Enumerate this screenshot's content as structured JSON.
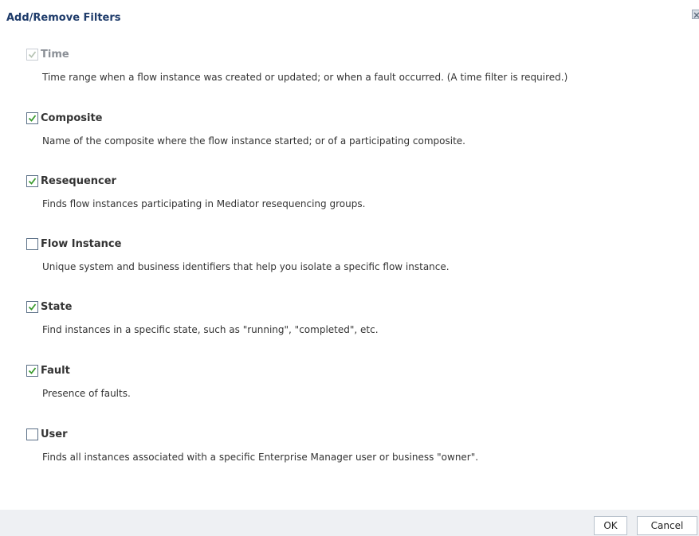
{
  "dialog": {
    "title": "Add/Remove Filters",
    "close_icon": "close-icon"
  },
  "filters": [
    {
      "label": "Time",
      "checked": true,
      "disabled": true,
      "description": "Time range when a flow instance was created or updated; or when a fault occurred. (A time filter is required.)"
    },
    {
      "label": "Composite",
      "checked": true,
      "disabled": false,
      "description": "Name of the composite where the flow instance started; or of a participating composite."
    },
    {
      "label": "Resequencer",
      "checked": true,
      "disabled": false,
      "description": "Finds flow instances participating in Mediator resequencing groups."
    },
    {
      "label": "Flow Instance",
      "checked": false,
      "disabled": false,
      "description": "Unique system and business identifiers that help you isolate a specific flow instance."
    },
    {
      "label": "State",
      "checked": true,
      "disabled": false,
      "description": "Find instances in a specific state, such as \"running\", \"completed\", etc."
    },
    {
      "label": "Fault",
      "checked": true,
      "disabled": false,
      "description": "Presence of faults."
    },
    {
      "label": "User",
      "checked": false,
      "disabled": false,
      "description": "Finds all instances associated with a specific Enterprise Manager user or business \"owner\"."
    }
  ],
  "footer": {
    "ok_label": "OK",
    "cancel_label": "Cancel"
  },
  "colors": {
    "title": "#1e3b6a",
    "check_enabled": "#3a9b2e",
    "check_disabled": "#b7c4b5",
    "footer_bg": "#eef0f3"
  }
}
